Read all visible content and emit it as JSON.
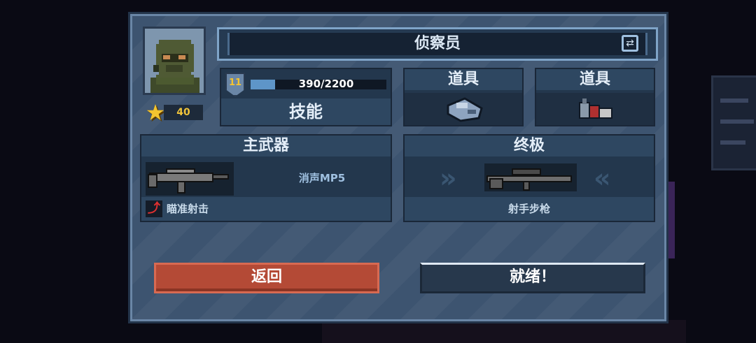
{
  "character": {
    "name": "侦察员",
    "star_count": "40",
    "level": "11",
    "xp_text": "390/2200",
    "xp_fraction": 0.18
  },
  "skill": {
    "label": "技能"
  },
  "items": [
    {
      "title": "道具",
      "icon": "grenade-icon"
    },
    {
      "title": "道具",
      "icon": "ammo-pack-icon"
    }
  ],
  "primary_weapon": {
    "title": "主武器",
    "weapon_name": "消声MP5",
    "ability": "瞄准射击"
  },
  "ultimate": {
    "title": "终极",
    "weapon_name": "射手步枪"
  },
  "buttons": {
    "back": "返回",
    "ready": "就绪！"
  },
  "colors": {
    "panel_bg": "#3d5470",
    "accent_gold": "#f4c430",
    "back_red": "#b44a36",
    "xp_fill": "#5e95c8"
  }
}
